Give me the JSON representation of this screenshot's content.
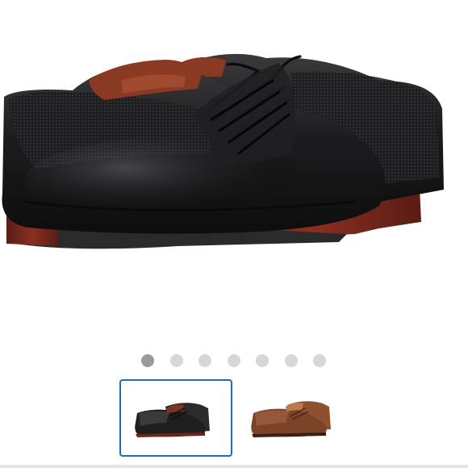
{
  "gallery": {
    "slide_count": 7,
    "active_index": 0
  },
  "hero": {
    "icon": "black-oxford-shoes",
    "colors": {
      "leather": "#1b1b1c",
      "sole": "#7a2a1e",
      "lining": "#8a3a22"
    }
  },
  "thumbnails": [
    {
      "variant": "black",
      "icon": "black-oxford-shoes-thumbnail",
      "selected": true,
      "color": "#1e1e20"
    },
    {
      "variant": "brown",
      "icon": "brown-oxford-shoes-thumbnail",
      "selected": false,
      "color": "#7b4328"
    }
  ],
  "colors": {
    "selected_border": "#1f6fa8",
    "dot_active": "#9a9a9a",
    "dot_inactive": "#d7d7d7"
  }
}
